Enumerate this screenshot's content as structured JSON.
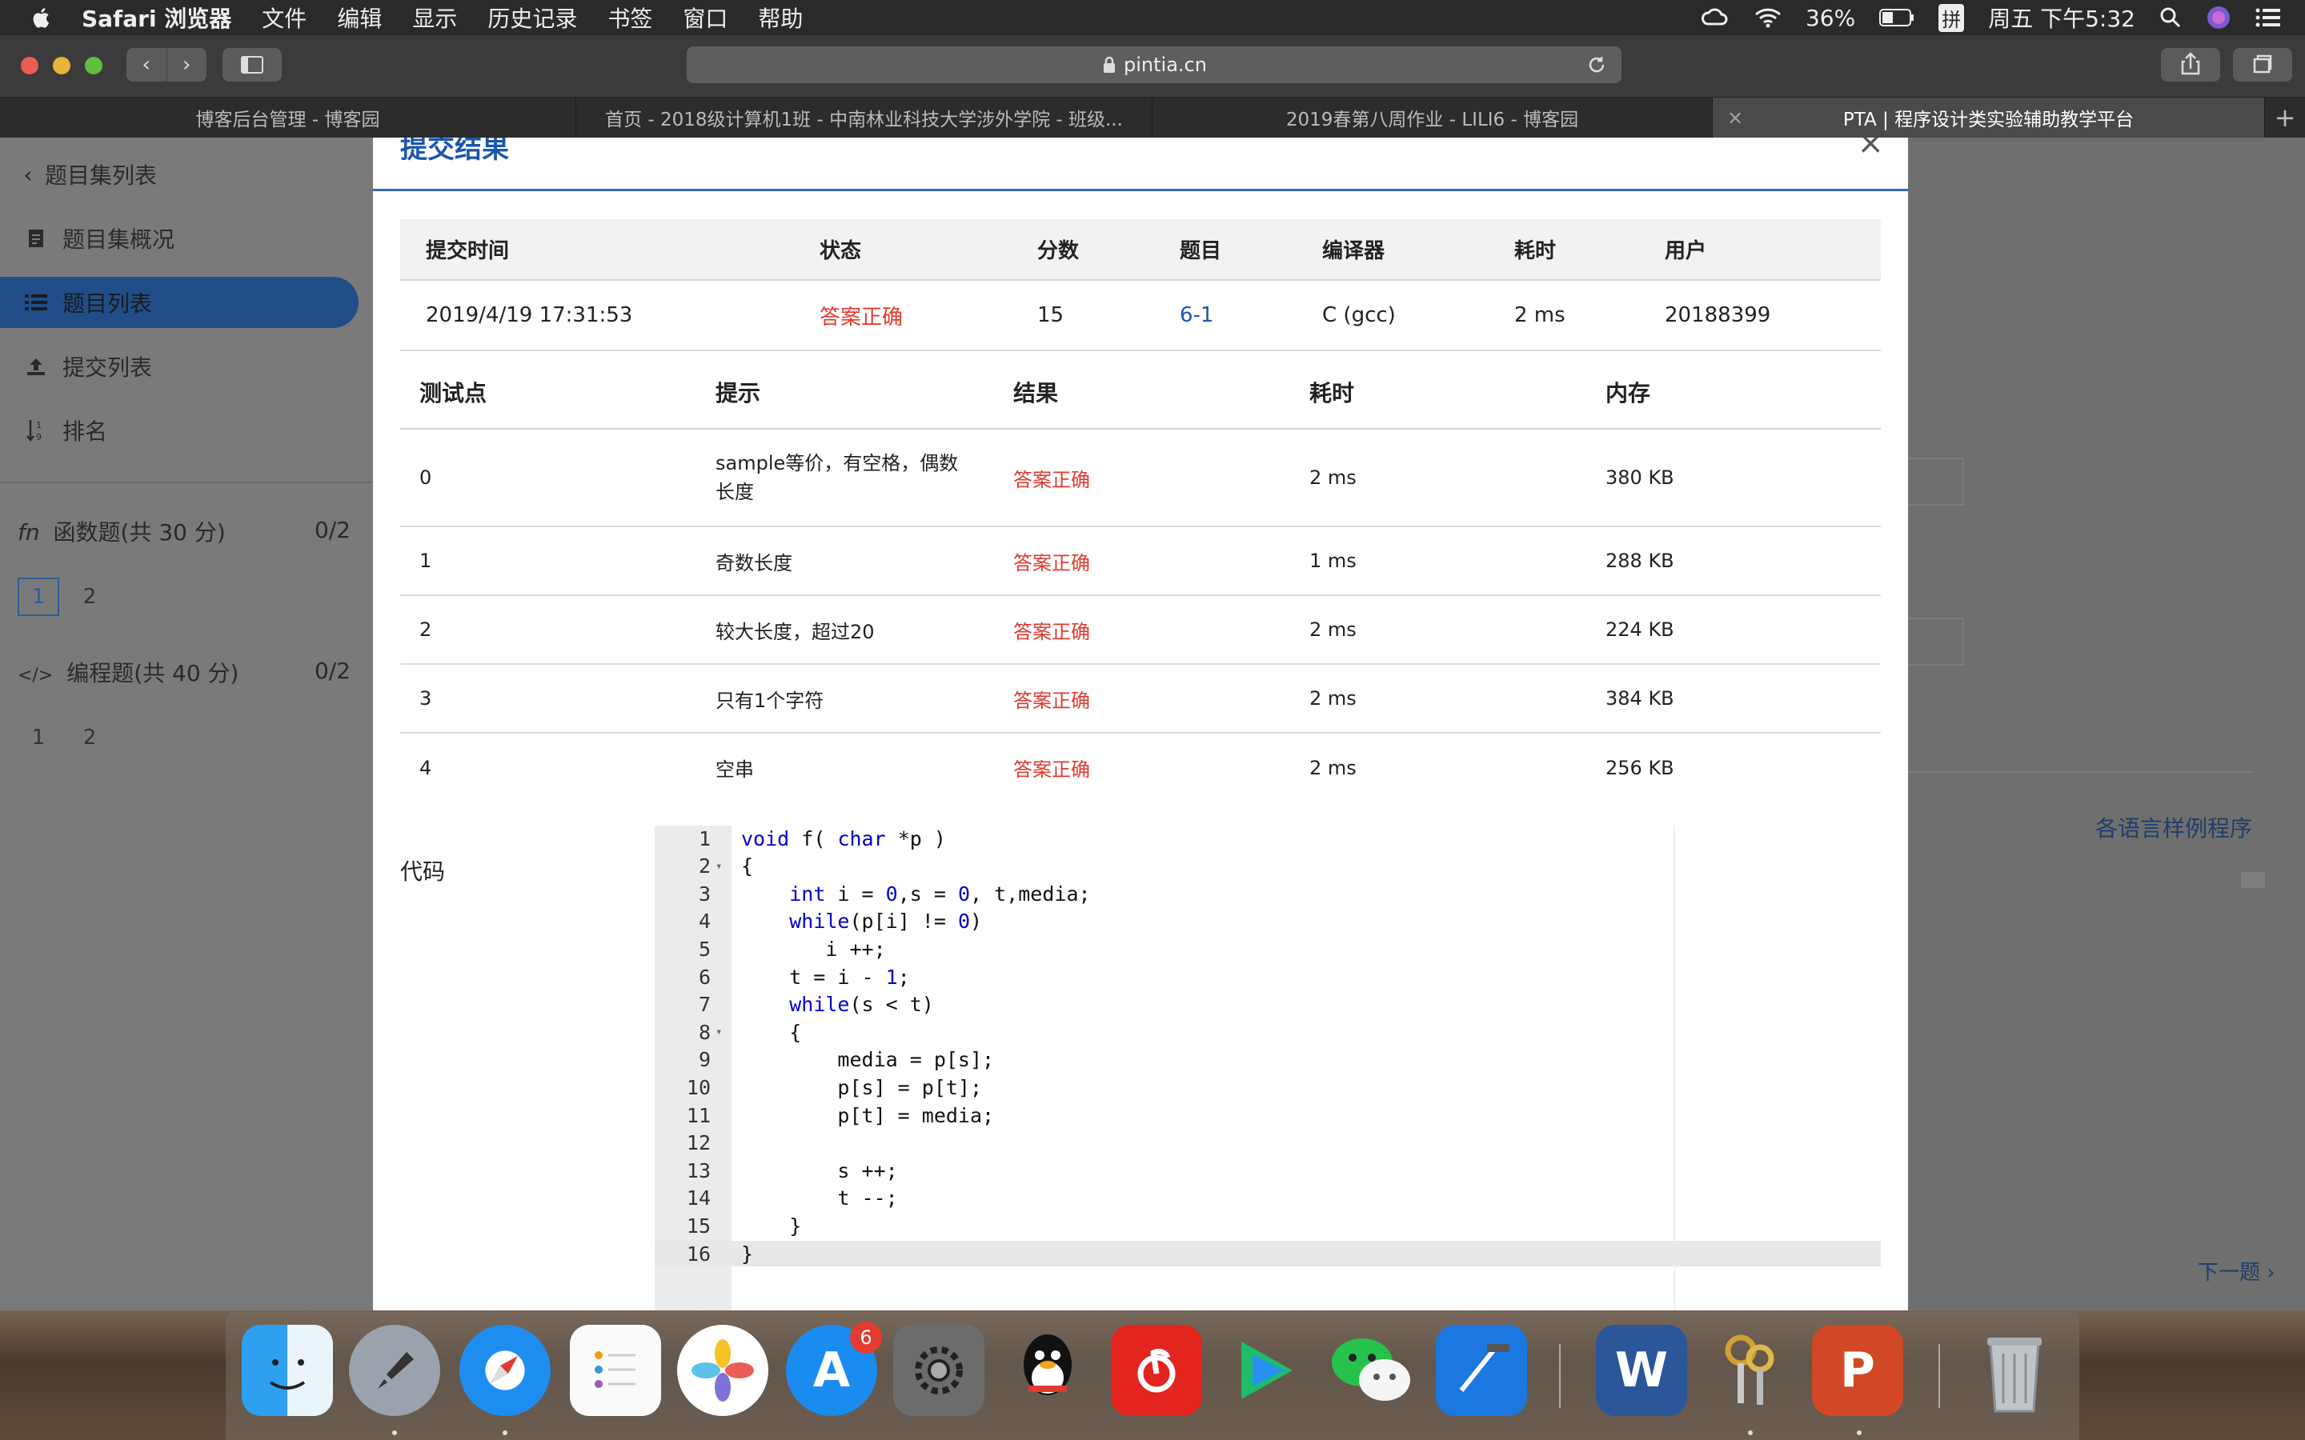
{
  "menubar": {
    "app": "Safari 浏览器",
    "items": [
      "文件",
      "编辑",
      "显示",
      "历史记录",
      "书签",
      "窗口",
      "帮助"
    ],
    "battery": "36%",
    "input_method": "拼",
    "clock": "周五 下午5:32"
  },
  "browser": {
    "url": "pintia.cn",
    "tabs": [
      {
        "title": "博客后台管理 - 博客园"
      },
      {
        "title": "首页 - 2018级计算机1班 - 中南林业科技大学涉外学院 - 班级..."
      },
      {
        "title": "2019春第八周作业 - LILI6 - 博客园"
      },
      {
        "title": "PTA | 程序设计类实验辅助教学平台"
      }
    ]
  },
  "sidebar": {
    "items": [
      {
        "label": "题目集列表",
        "icon": "chevron-left-icon"
      },
      {
        "label": "题目集概况",
        "icon": "document-icon"
      },
      {
        "label": "题目列表",
        "icon": "list-icon"
      },
      {
        "label": "提交列表",
        "icon": "upload-icon"
      },
      {
        "label": "排名",
        "icon": "sort-icon"
      }
    ],
    "sections": [
      {
        "title": "函数题(共 30 分)",
        "score": "0/2",
        "icon": "function-icon",
        "problems": [
          "1",
          "2"
        ]
      },
      {
        "title": "编程题(共 40 分)",
        "score": "0/2",
        "icon": "code-icon",
        "problems": [
          "1",
          "2"
        ]
      }
    ]
  },
  "modal": {
    "title": "提交结果",
    "close": "×",
    "summary_headers": [
      "提交时间",
      "状态",
      "分数",
      "题目",
      "编译器",
      "耗时",
      "用户"
    ],
    "summary_row": [
      "2019/4/19 17:31:53",
      "答案正确",
      "15",
      "6-1",
      "C (gcc)",
      "2 ms",
      "20188399"
    ],
    "test_headers": [
      "测试点",
      "提示",
      "结果",
      "耗时",
      "内存"
    ],
    "tests": [
      [
        "0",
        "sample等价，有空格，偶数长度",
        "答案正确",
        "2 ms",
        "380 KB"
      ],
      [
        "1",
        "奇数长度",
        "答案正确",
        "1 ms",
        "288 KB"
      ],
      [
        "2",
        "较大长度，超过20",
        "答案正确",
        "2 ms",
        "224 KB"
      ],
      [
        "3",
        "只有1个字符",
        "答案正确",
        "2 ms",
        "384 KB"
      ],
      [
        "4",
        "空串",
        "答案正确",
        "2 ms",
        "256 KB"
      ]
    ],
    "code_label": "代码",
    "code_lines": [
      "void f( char *p )",
      "{",
      "    int i = 0,s = 0, t,media;",
      "    while(p[i] != 0)",
      "       i ++;",
      "    t = i - 1;",
      "    while(s < t)",
      "    {",
      "        media = p[s];",
      "        p[s] = p[t];",
      "        p[t] = media;",
      "",
      "        s ++;",
      "        t --;",
      "    }",
      "}"
    ]
  },
  "right": {
    "examples_link": "各语言样例程序",
    "next_link": "下一题"
  },
  "dock": {
    "appstore_badge": "6"
  }
}
